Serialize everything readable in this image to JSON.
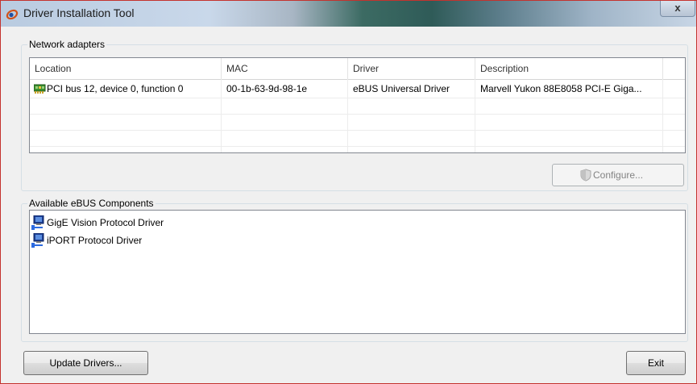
{
  "window": {
    "title": "Driver Installation Tool",
    "close_glyph": "x"
  },
  "network": {
    "group_label": "Network adapters",
    "columns": [
      "Location",
      "MAC",
      "Driver",
      "Description"
    ],
    "rows": [
      {
        "icon": "network-card-icon",
        "location": "PCI bus 12, device 0, function 0",
        "mac": "00-1b-63-9d-98-1e",
        "driver": "eBUS Universal Driver",
        "description": "Marvell Yukon 88E8058 PCI-E Giga..."
      }
    ],
    "configure_label": "Configure..."
  },
  "components": {
    "group_label": "Available eBUS Components",
    "items": [
      {
        "icon": "computer-network-icon",
        "label": "GigE Vision Protocol Driver"
      },
      {
        "icon": "computer-network-icon",
        "label": "iPORT Protocol Driver"
      }
    ]
  },
  "footer": {
    "update_label": "Update Drivers...",
    "exit_label": "Exit"
  },
  "colors": {
    "window_border": "#c4332e",
    "client_bg": "#f0f0f0",
    "list_border": "#828790"
  }
}
